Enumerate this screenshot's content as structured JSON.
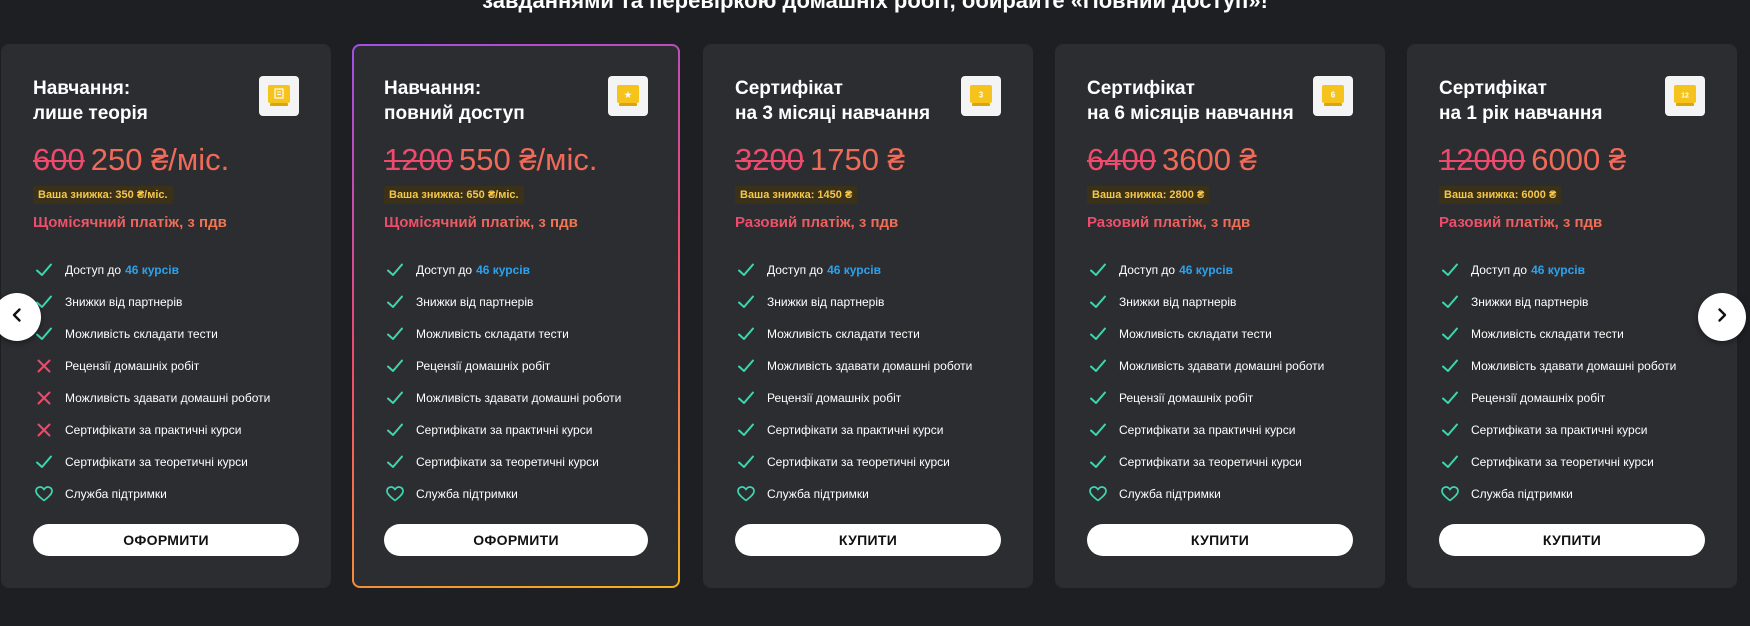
{
  "intro_text": "завданнями та перевіркою домашніх робіт, обирайте «Повний доступ»!",
  "colors": {
    "check": "#3ed5b1",
    "cross": "#ee4a6d",
    "heart": "#3ed5b1",
    "link": "#2aa3ee",
    "badge_gold": "#f5c31c"
  },
  "cards": [
    {
      "title": "Навчання:\nлише теорія",
      "title_line1": "Навчання:",
      "title_line2": "лише теорія",
      "badge_icon": "book-icon",
      "badge_label": "",
      "old_price": "600",
      "new_price": "250 ₴/міс.",
      "discount": "Ваша знижка: 350 ₴/міс.",
      "payment": "Щомісячний платіж, з пдв",
      "featured": false,
      "features": [
        {
          "icon": "check",
          "text": "Доступ до",
          "link": "46 курсів"
        },
        {
          "icon": "check",
          "text": "Знижки від партнерів"
        },
        {
          "icon": "check",
          "text": "Можливість складати тести"
        },
        {
          "icon": "cross",
          "text": "Рецензії домашніх робіт"
        },
        {
          "icon": "cross",
          "text": "Можливість здавати домашні роботи"
        },
        {
          "icon": "cross",
          "text": "Сертифікати за практичні курси"
        },
        {
          "icon": "check",
          "text": "Сертифікати за теоретичні курси"
        },
        {
          "icon": "heart",
          "text": "Служба підтримки"
        }
      ],
      "button": "ОФОРМИТИ"
    },
    {
      "title_line1": "Навчання:",
      "title_line2": "повний доступ",
      "badge_icon": "star-icon",
      "badge_label": "★",
      "old_price": "1200",
      "new_price": "550 ₴/міс.",
      "discount": "Ваша знижка: 650 ₴/міс.",
      "payment": "Щомісячний платіж, з пдв",
      "featured": true,
      "features": [
        {
          "icon": "check",
          "text": "Доступ до",
          "link": "46 курсів"
        },
        {
          "icon": "check",
          "text": "Знижки від партнерів"
        },
        {
          "icon": "check",
          "text": "Можливість складати тести"
        },
        {
          "icon": "check",
          "text": "Рецензії домашніх робіт"
        },
        {
          "icon": "check",
          "text": "Можливість здавати домашні роботи"
        },
        {
          "icon": "check",
          "text": "Сертифікати за практичні курси"
        },
        {
          "icon": "check",
          "text": "Сертифікати за теоретичні курси"
        },
        {
          "icon": "heart",
          "text": "Служба підтримки"
        }
      ],
      "button": "ОФОРМИТИ"
    },
    {
      "title_line1": "Сертифікат",
      "title_line2": "на 3 місяці навчання",
      "badge_icon": "medal-3-icon",
      "badge_label": "3",
      "old_price": "3200",
      "new_price": "1750 ₴",
      "discount": "Ваша знижка: 1450 ₴",
      "payment": "Разовий платіж, з пдв",
      "featured": false,
      "features": [
        {
          "icon": "check",
          "text": "Доступ до",
          "link": "46 курсів"
        },
        {
          "icon": "check",
          "text": "Знижки від партнерів"
        },
        {
          "icon": "check",
          "text": "Можливість складати тести"
        },
        {
          "icon": "check",
          "text": "Можливість здавати домашні роботи"
        },
        {
          "icon": "check",
          "text": "Рецензії домашніх робіт"
        },
        {
          "icon": "check",
          "text": "Сертифікати за практичні курси"
        },
        {
          "icon": "check",
          "text": "Сертифікати за теоретичні курси"
        },
        {
          "icon": "heart",
          "text": "Служба підтримки"
        }
      ],
      "button": "КУПИТИ"
    },
    {
      "title_line1": "Сертифікат",
      "title_line2": "на 6 місяців навчання",
      "badge_icon": "medal-6-icon",
      "badge_label": "6",
      "old_price": "6400",
      "new_price": "3600 ₴",
      "discount": "Ваша знижка: 2800 ₴",
      "payment": "Разовий платіж, з пдв",
      "featured": false,
      "features": [
        {
          "icon": "check",
          "text": "Доступ до",
          "link": "46 курсів"
        },
        {
          "icon": "check",
          "text": "Знижки від партнерів"
        },
        {
          "icon": "check",
          "text": "Можливість складати тести"
        },
        {
          "icon": "check",
          "text": "Можливість здавати домашні роботи"
        },
        {
          "icon": "check",
          "text": "Рецензії домашніх робіт"
        },
        {
          "icon": "check",
          "text": "Сертифікати за практичні курси"
        },
        {
          "icon": "check",
          "text": "Сертифікати за теоретичні курси"
        },
        {
          "icon": "heart",
          "text": "Служба підтримки"
        }
      ],
      "button": "КУПИТИ"
    },
    {
      "title_line1": "Сертифікат",
      "title_line2": "на 1 рік навчання",
      "badge_icon": "medal-12-icon",
      "badge_label": "12",
      "old_price": "12000",
      "new_price": "6000 ₴",
      "discount": "Ваша знижка: 6000 ₴",
      "payment": "Разовий платіж, з пдв",
      "featured": false,
      "features": [
        {
          "icon": "check",
          "text": "Доступ до",
          "link": "46 курсів"
        },
        {
          "icon": "check",
          "text": "Знижки від партнерів"
        },
        {
          "icon": "check",
          "text": "Можливість складати тести"
        },
        {
          "icon": "check",
          "text": "Можливість здавати домашні роботи"
        },
        {
          "icon": "check",
          "text": "Рецензії домашніх робіт"
        },
        {
          "icon": "check",
          "text": "Сертифікати за практичні курси"
        },
        {
          "icon": "check",
          "text": "Сертифікати за теоретичні курси"
        },
        {
          "icon": "heart",
          "text": "Служба підтримки"
        }
      ],
      "button": "КУПИТИ"
    }
  ],
  "navigation": {
    "prev_icon": "chevron-left-icon",
    "next_icon": "chevron-right-icon"
  }
}
